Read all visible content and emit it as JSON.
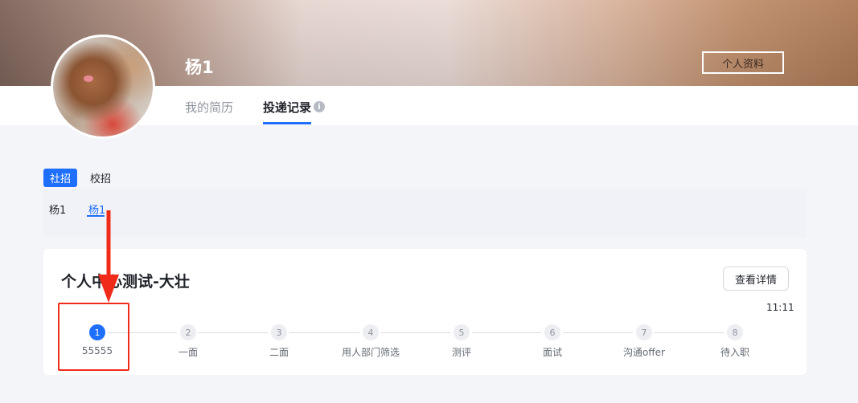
{
  "header": {
    "user_name": "杨1",
    "profile_button": "个人资料",
    "tabs": [
      {
        "label": "我的简历",
        "active": false
      },
      {
        "label": "投递记录",
        "active": true
      }
    ],
    "info_icon": "i"
  },
  "filters": {
    "recruit_types": [
      {
        "label": "社招",
        "active": true
      },
      {
        "label": "校招",
        "active": false
      }
    ],
    "candidates": [
      {
        "label": "杨1",
        "active": false
      },
      {
        "label": "杨1",
        "active": true
      }
    ]
  },
  "application": {
    "title": "个人中心测试-大壮",
    "detail_button": "查看详情",
    "time": "11:11",
    "current_step": 1,
    "steps": [
      {
        "number": "1",
        "label": "55555"
      },
      {
        "number": "2",
        "label": "一面"
      },
      {
        "number": "3",
        "label": "二面"
      },
      {
        "number": "4",
        "label": "用人部门筛选"
      },
      {
        "number": "5",
        "label": "测评"
      },
      {
        "number": "6",
        "label": "面试"
      },
      {
        "number": "7",
        "label": "沟通offer"
      },
      {
        "number": "8",
        "label": "待入职"
      }
    ]
  },
  "colors": {
    "accent": "#1f6fff",
    "annotation": "#f02b1a"
  },
  "icons": [
    "info-icon",
    "avatar-image",
    "annotation-arrow"
  ]
}
